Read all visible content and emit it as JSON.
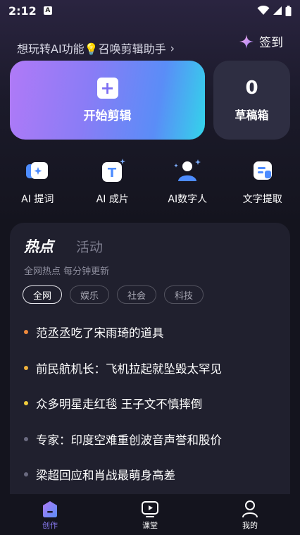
{
  "status_bar": {
    "time": "2:12",
    "notification_badge": "A"
  },
  "header": {
    "promo_text": "想玩转AI功能💡召唤剪辑助手",
    "checkin_label": "签到"
  },
  "start_card": {
    "label": "开始剪辑"
  },
  "draft_card": {
    "count": "0",
    "label": "草稿箱"
  },
  "tools": [
    {
      "label": "AI 提词",
      "icon": "teleprompter-icon"
    },
    {
      "label": "AI 成片",
      "icon": "ai-video-icon"
    },
    {
      "label": "AI数字人",
      "icon": "digital-human-icon"
    },
    {
      "label": "文字提取",
      "icon": "text-extract-icon"
    }
  ],
  "hot": {
    "tab_hot": "热点",
    "tab_event": "活动",
    "subtitle": "全网热点 每分钟更新",
    "chips": [
      "全网",
      "娱乐",
      "社会",
      "科技"
    ],
    "items": [
      {
        "text": "范丞丞吃了宋雨琦的道具",
        "dot_color": "#f08a3c"
      },
      {
        "text": "前民航机长：飞机拉起就坠毁太罕见",
        "dot_color": "#f0b23c"
      },
      {
        "text": "众多明星走红毯 王子文不慎摔倒",
        "dot_color": "#f0cc3c"
      },
      {
        "text": "专家：印度空难重创波音声誉和股价",
        "dot_color": "#6a6a80"
      },
      {
        "text": "梁超回应和肖战最萌身高差",
        "dot_color": "#6a6a80"
      }
    ]
  },
  "tabbar": [
    {
      "label": "创作",
      "icon": "create-icon",
      "active": true
    },
    {
      "label": "课堂",
      "icon": "classroom-icon",
      "active": false
    },
    {
      "label": "我的",
      "icon": "profile-icon",
      "active": false
    }
  ],
  "colors": {
    "accent": "#7d6ff2",
    "active_tab": "#8a7cf6",
    "inactive_tab": "#ffffff"
  }
}
